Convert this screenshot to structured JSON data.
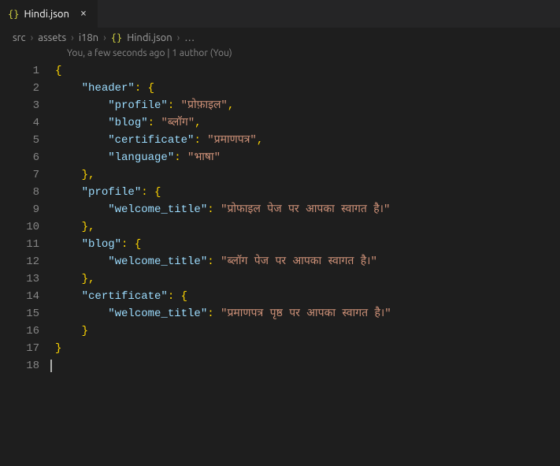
{
  "tab": {
    "icon_glyph": "{}",
    "label": "Hindi.json",
    "close_glyph": "×"
  },
  "breadcrumbs": {
    "seg1": "src",
    "seg2": "assets",
    "seg3": "i18n",
    "icon_glyph": "{}",
    "seg4": "Hindi.json",
    "seg5": "…",
    "sep": "›"
  },
  "codelens": "You, a few seconds ago | 1 author (You)",
  "line_numbers": [
    "1",
    "2",
    "3",
    "4",
    "5",
    "6",
    "7",
    "8",
    "9",
    "10",
    "11",
    "12",
    "13",
    "14",
    "15",
    "16",
    "17",
    "18"
  ],
  "json": {
    "header_key": "\"header\"",
    "profile_key": "\"profile\"",
    "profile_val": "\"प्रोफ़ाइल\"",
    "blog_key": "\"blog\"",
    "blog_val": "\"ब्लॉग\"",
    "certificate_key": "\"certificate\"",
    "certificate_val": "\"प्रमाणपत्र\"",
    "language_key": "\"language\"",
    "language_val": "\"भाषा\"",
    "profile_obj_key": "\"profile\"",
    "welcome_key": "\"welcome_title\"",
    "profile_welcome_val": "\"प्रोफाइल पेज पर आपका स्वागत है।\"",
    "blog_obj_key": "\"blog\"",
    "blog_welcome_val": "\"ब्लॉग पेज पर आपका स्वागत है।\"",
    "cert_obj_key": "\"certificate\"",
    "cert_welcome_val": "\"प्रमाणपत्र पृष्ठ पर आपका स्वागत है।\""
  }
}
